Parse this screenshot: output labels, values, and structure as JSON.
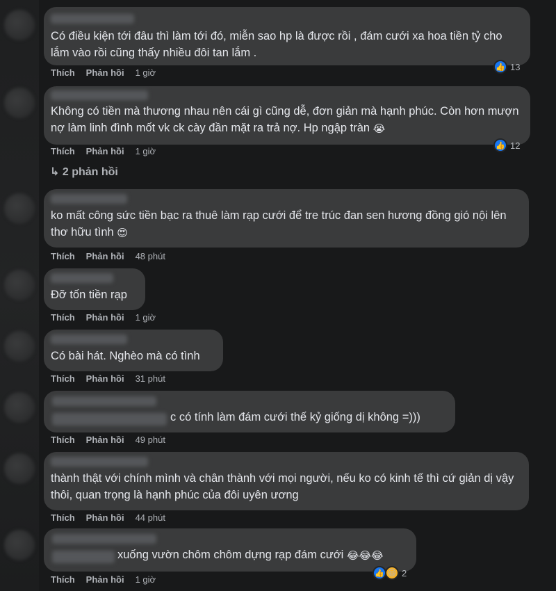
{
  "comments": [
    {
      "text": "Có điều kiện tới đâu thì làm tới đó, miễn sao hp là được rồi , đám cưới xa hoa tiền tỷ cho lắm vào rồi cũng thấy nhiều đôi tan lắm .",
      "like": "Thích",
      "reply": "Phản hồi",
      "time": "1 giờ",
      "reactions": "13"
    },
    {
      "text": "Không có tiền mà thương nhau nên cái gì cũng dễ, đơn giản mà hạnh phúc. Còn hơn mượn nợ làm linh đình mốt vk ck cày đần mặt ra trả nợ. Hp ngập tràn",
      "emoji": "😭",
      "like": "Thích",
      "reply": "Phản hồi",
      "time": "1 giờ",
      "reactions": "12",
      "replies": "↳ 2 phản hồi"
    },
    {
      "text": "ko mất công sức tiền bạc ra thuê làm rạp cưới để tre trúc đan sen hương đồng gió nội lên thơ hữu tình",
      "emoji": "😍",
      "like": "Thích",
      "reply": "Phản hồi",
      "time": "48 phút"
    },
    {
      "text": "Đỡ tốn tiền rạp",
      "like": "Thích",
      "reply": "Phản hồi",
      "time": "1 giờ"
    },
    {
      "text": "Có bài hát. Nghèo mà có tình",
      "like": "Thích",
      "reply": "Phản hồi",
      "time": "31 phút"
    },
    {
      "text": "c có tính làm đám cưới thế kỷ giống dị không =)))",
      "like": "Thích",
      "reply": "Phản hồi",
      "time": "49 phút"
    },
    {
      "text": "thành thật với chính mình và chân thành với mọi người, nếu ko có kinh tế thì cứ giản dị vậy thôi, quan trọng là hạnh phúc của đôi uyên ương",
      "like": "Thích",
      "reply": "Phản hồi",
      "time": "44 phút"
    },
    {
      "text": "xuống vườn chôm chôm dựng rạp đám cưới",
      "emoji": "😂😂😂",
      "like": "Thích",
      "reply": "Phản hồi",
      "time": "1 giờ",
      "reactions": "2"
    }
  ],
  "icons": {
    "like": "like-icon",
    "haha": "haha-icon"
  },
  "colors": {
    "background": "#18191a",
    "bubble": "#3a3b3c",
    "like_blue": "#1877f2"
  }
}
